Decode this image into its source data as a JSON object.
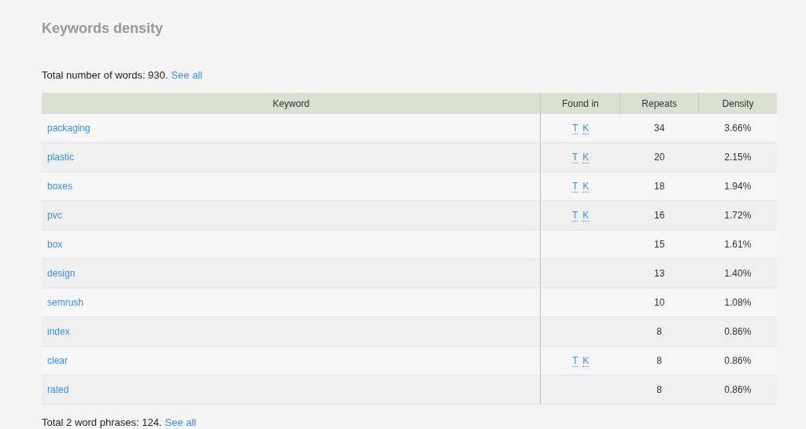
{
  "title": "Keywords density",
  "summary": {
    "text": "Total number of words: 930.",
    "link": "See all"
  },
  "table": {
    "columns": [
      "Keyword",
      "Found in",
      "Repeats",
      "Density"
    ],
    "rows": [
      {
        "keyword": "packaging",
        "found_in": [
          "T",
          "K"
        ],
        "repeats": "34",
        "density": "3.66%"
      },
      {
        "keyword": "plastic",
        "found_in": [
          "T",
          "K"
        ],
        "repeats": "20",
        "density": "2.15%"
      },
      {
        "keyword": "boxes",
        "found_in": [
          "T",
          "K"
        ],
        "repeats": "18",
        "density": "1.94%"
      },
      {
        "keyword": "pvc",
        "found_in": [
          "T",
          "K"
        ],
        "repeats": "16",
        "density": "1.72%"
      },
      {
        "keyword": "box",
        "repeats": "15",
        "density": "1.61%"
      },
      {
        "keyword": "design",
        "repeats": "13",
        "density": "1.40%"
      },
      {
        "keyword": "semrush",
        "repeats": "10",
        "density": "1.08%"
      },
      {
        "keyword": "index",
        "repeats": "8",
        "density": "0.86%"
      },
      {
        "keyword": "clear",
        "found_in": [
          "T",
          "K"
        ],
        "repeats": "8",
        "density": "0.86%"
      },
      {
        "keyword": "rated",
        "repeats": "8",
        "density": "0.86%"
      }
    ]
  },
  "footer": {
    "text": "Total 2 word phrases: 124.",
    "link": "See all"
  }
}
